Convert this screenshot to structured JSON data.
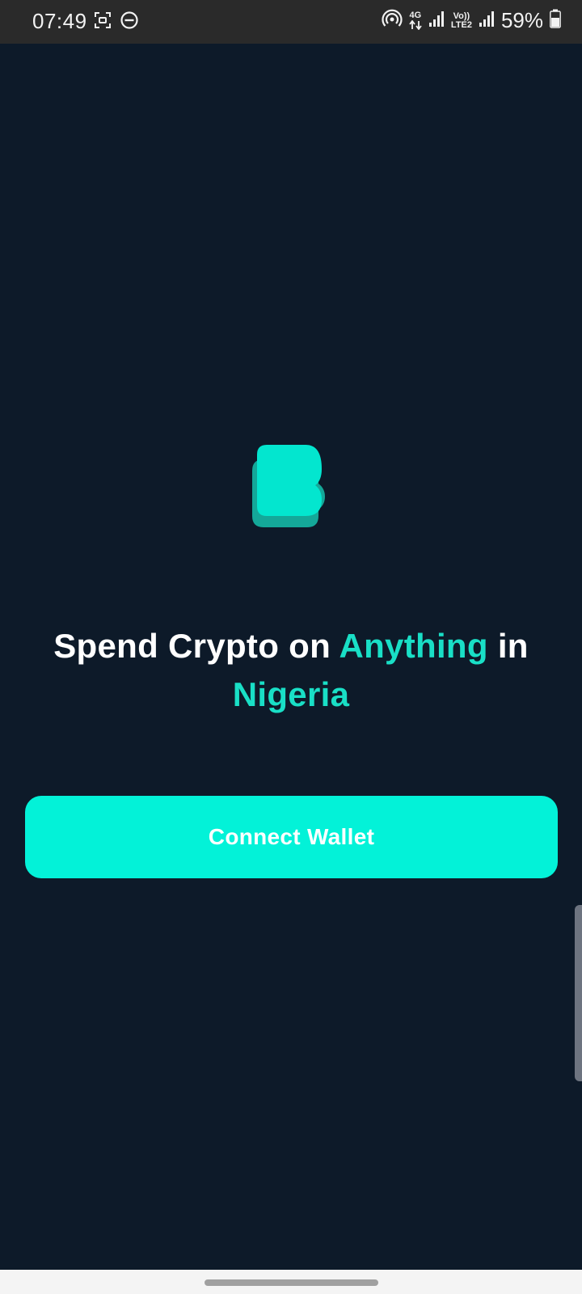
{
  "status_bar": {
    "time": "07:49",
    "network_type": "4G",
    "volte_top": "Vo))",
    "volte_bottom": "LTE2",
    "battery_percent": "59%",
    "icons": [
      "screenshot-icon",
      "do-not-disturb-icon",
      "hotspot-icon",
      "data-arrows-icon",
      "signal-icon",
      "signal-icon-2",
      "battery-icon"
    ]
  },
  "app": {
    "logo": "app-logo",
    "headline": {
      "part1": "Spend Crypto on ",
      "accent1": "Anything",
      "part2": " in ",
      "accent2": "Nigeria"
    },
    "connect_button_label": "Connect Wallet",
    "colors": {
      "background": "#0d1a29",
      "accent": "#19dfc6",
      "button": "#03f2d8"
    }
  }
}
